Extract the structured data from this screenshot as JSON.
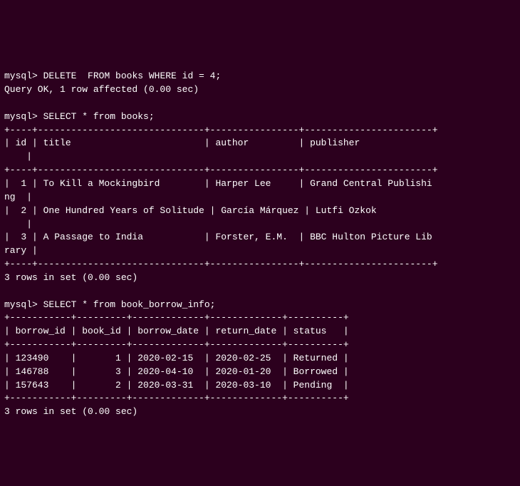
{
  "session": {
    "cmd1_prompt": "mysql>",
    "cmd1": "DELETE  FROM books WHERE id = 4;",
    "cmd1_result": "Query OK, 1 row affected (0.00 sec)",
    "cmd2_prompt": "mysql>",
    "cmd2": "SELECT * from books;",
    "books_border_top": "+----+------------------------------+----------------+-----------------------+",
    "books_header_line1": "| id | title                        | author         | publisher             ",
    "books_header_line2": "    |",
    "books_sep": "+----+------------------------------+----------------+-----------------------+",
    "books_row1_line1": "|  1 | To Kill a Mockingbird        | Harper Lee     | Grand Central Publishi",
    "books_row1_line2": "ng  |",
    "books_row2_line1": "|  2 | One Hundred Years of Solitude | García Márquez | Lutfi Ozkok          ",
    "books_row2_line2": "    |",
    "books_row3_line1": "|  3 | A Passage to India           | Forster, E.M.  | BBC Hulton Picture Lib",
    "books_row3_line2": "rary |",
    "books_border_bot": "+----+------------------------------+----------------+-----------------------+",
    "books_footer": "3 rows in set (0.00 sec)",
    "cmd3_prompt": "mysql>",
    "cmd3": "SELECT * from book_borrow_info;",
    "borrow_border": "+-----------+---------+-------------+-------------+----------+",
    "borrow_header": "| borrow_id | book_id | borrow_date | return_date | status   |",
    "borrow_row1": "| 123490    |       1 | 2020-02-15  | 2020-02-25  | Returned |",
    "borrow_row2": "| 146788    |       3 | 2020-04-10  | 2020-01-20  | Borrowed |",
    "borrow_row3": "| 157643    |       2 | 2020-03-31  | 2020-03-10  | Pending  |",
    "borrow_footer": "3 rows in set (0.00 sec)"
  }
}
